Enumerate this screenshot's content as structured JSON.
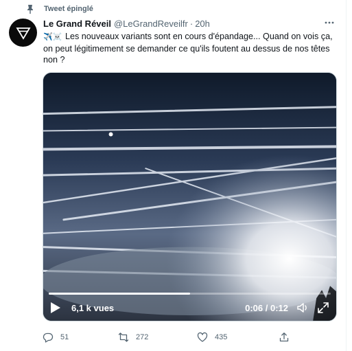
{
  "pinned_label": "Tweet épinglé",
  "author": {
    "display_name": "Le Grand Réveil",
    "handle": "@LeGrandReveilfr",
    "separator": "·",
    "time": "20h"
  },
  "tweet_text": "Les nouveaux variants sont en cours d'épandage... Quand on vois ça, on peut légitimement se demander ce qu'ils foutent au dessus de nos têtes non ?",
  "emojis": "✈️☠️",
  "video": {
    "views": "6,1 k vues",
    "time": "0:06 / 0:12",
    "progress": 0.5
  },
  "actions": {
    "replies": "51",
    "retweets": "272",
    "likes": "435"
  },
  "colors": {
    "text_primary": "#0f1419",
    "text_secondary": "#536471",
    "border": "#cfd9de"
  }
}
